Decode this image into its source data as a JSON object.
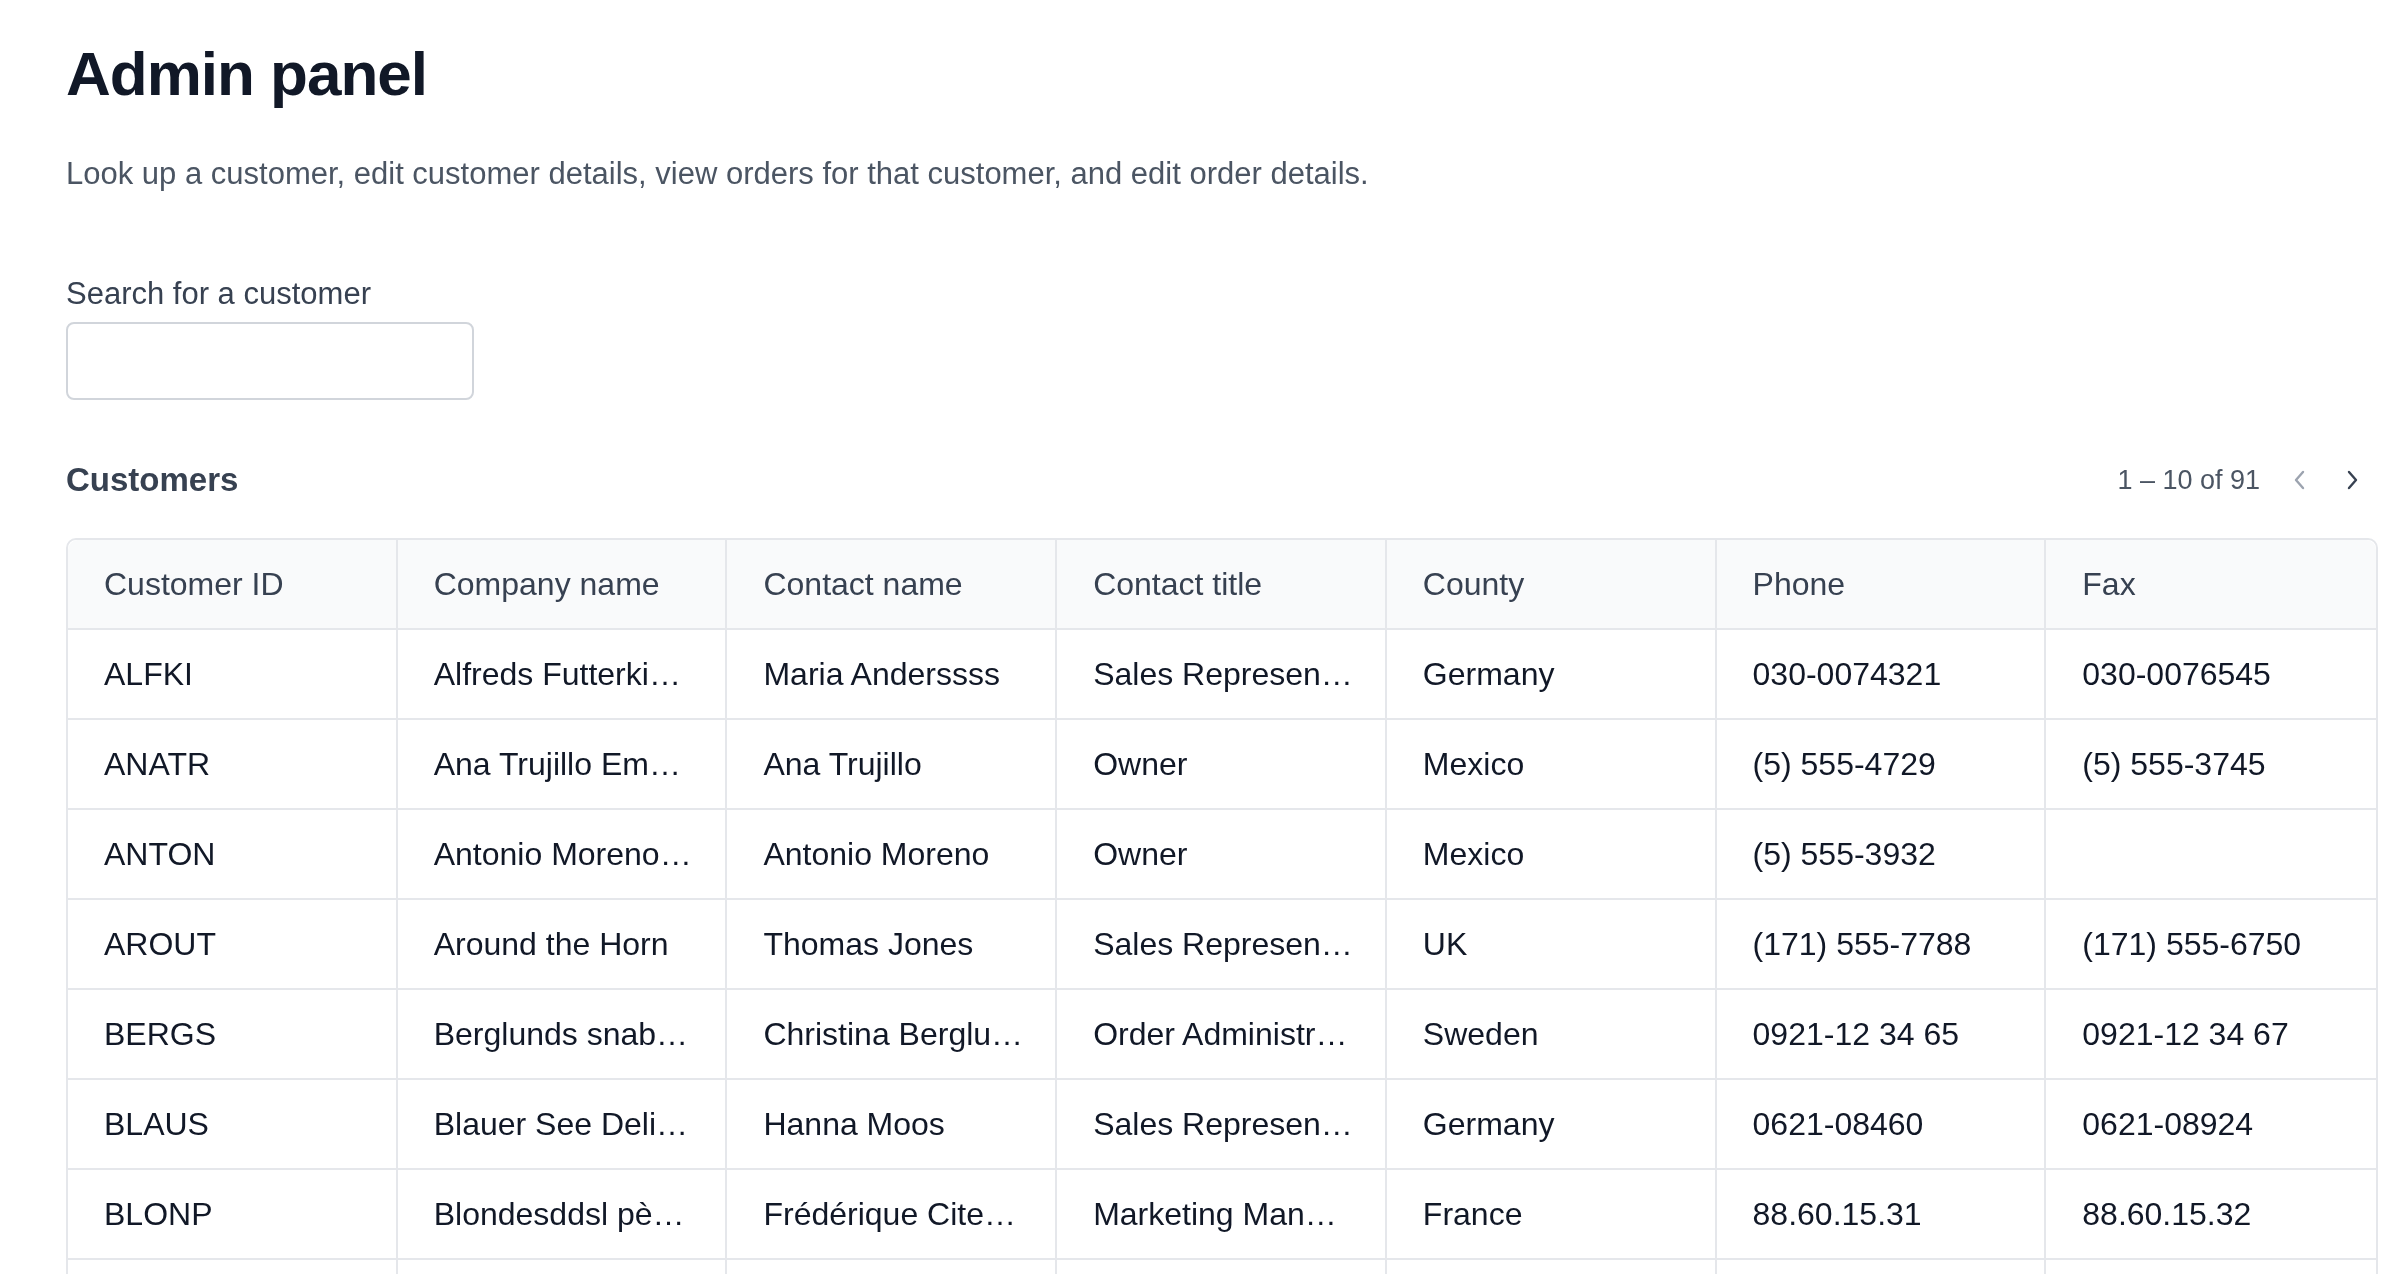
{
  "title": "Admin panel",
  "description": "Look up a customer, edit customer details, view orders for that customer, and edit order details.",
  "search": {
    "label": "Search for a customer"
  },
  "customers": {
    "heading": "Customers",
    "pagination": {
      "range": "1 – 10 of 91",
      "prev_disabled": true,
      "next_disabled": false
    },
    "columns": [
      "Customer ID",
      "Company name",
      "Contact name",
      "Contact title",
      "County",
      "Phone",
      "Fax"
    ],
    "rows": [
      [
        "ALFKI",
        "Alfreds Futterki…",
        "Maria Anderssss",
        "Sales Represen…",
        "Germany",
        "030-0074321",
        "030-0076545"
      ],
      [
        "ANATR",
        "Ana Trujillo Em…",
        "Ana Trujillo",
        "Owner",
        "Mexico",
        "(5) 555-4729",
        "(5) 555-3745"
      ],
      [
        "ANTON",
        "Antonio Moreno…",
        "Antonio Moreno",
        "Owner",
        "Mexico",
        "(5) 555-3932",
        ""
      ],
      [
        "AROUT",
        "Around the Horn",
        "Thomas Jones",
        "Sales Represen…",
        "UK",
        "(171) 555-7788",
        "(171) 555-6750"
      ],
      [
        "BERGS",
        "Berglunds snab…",
        "Christina Berglu…",
        "Order Administr…",
        "Sweden",
        "0921-12 34 65",
        "0921-12 34 67"
      ],
      [
        "BLAUS",
        "Blauer See Deli…",
        "Hanna Moos",
        "Sales Represen…",
        "Germany",
        "0621-08460",
        "0621-08924"
      ],
      [
        "BLONP",
        "Blondesddsl pè…",
        "Frédérique Cite…",
        "Marketing Man…",
        "France",
        "88.60.15.31",
        "88.60.15.32"
      ]
    ]
  }
}
